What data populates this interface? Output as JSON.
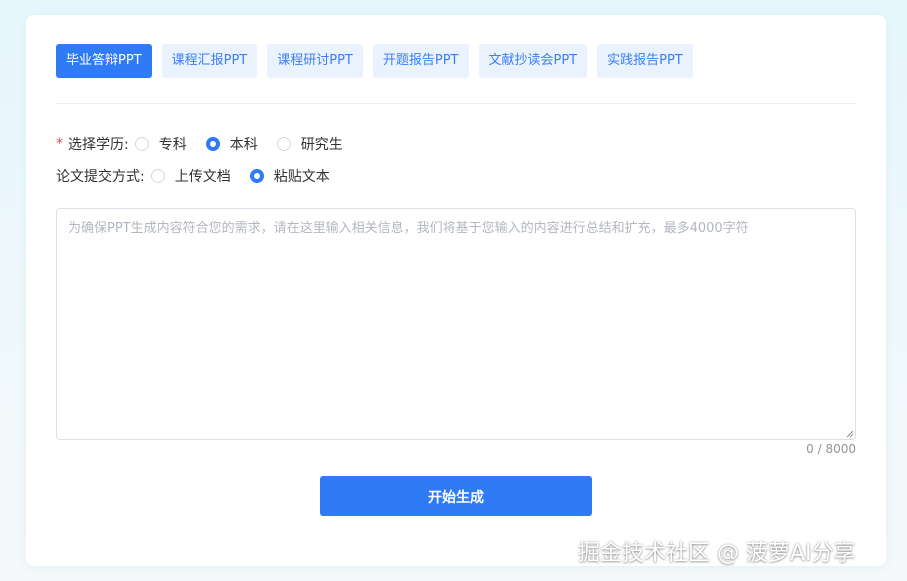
{
  "tabs": [
    {
      "label": "毕业答辩PPT",
      "active": true
    },
    {
      "label": "课程汇报PPT",
      "active": false
    },
    {
      "label": "课程研讨PPT",
      "active": false
    },
    {
      "label": "开题报告PPT",
      "active": false
    },
    {
      "label": "文献抄读会PPT",
      "active": false
    },
    {
      "label": "实践报告PPT",
      "active": false
    }
  ],
  "education": {
    "required_mark": "*",
    "label": "选择学历:",
    "options": [
      "专科",
      "本科",
      "研究生"
    ],
    "selected": "本科"
  },
  "submission": {
    "label": "论文提交方式:",
    "options": [
      "上传文档",
      "粘贴文本"
    ],
    "selected": "粘贴文本"
  },
  "textarea": {
    "value": "",
    "placeholder": "为确保PPT生成内容符合您的需求，请在这里输入相关信息，我们将基于您输入的内容进行总结和扩充，最多4000字符"
  },
  "counter": "0 / 8000",
  "generate_button": "开始生成",
  "watermark": "掘金技术社区 @ 菠萝AI分享",
  "colors": {
    "primary": "#2f7bf6",
    "tab_bg": "#eaf2fe",
    "required": "#f0484d"
  }
}
